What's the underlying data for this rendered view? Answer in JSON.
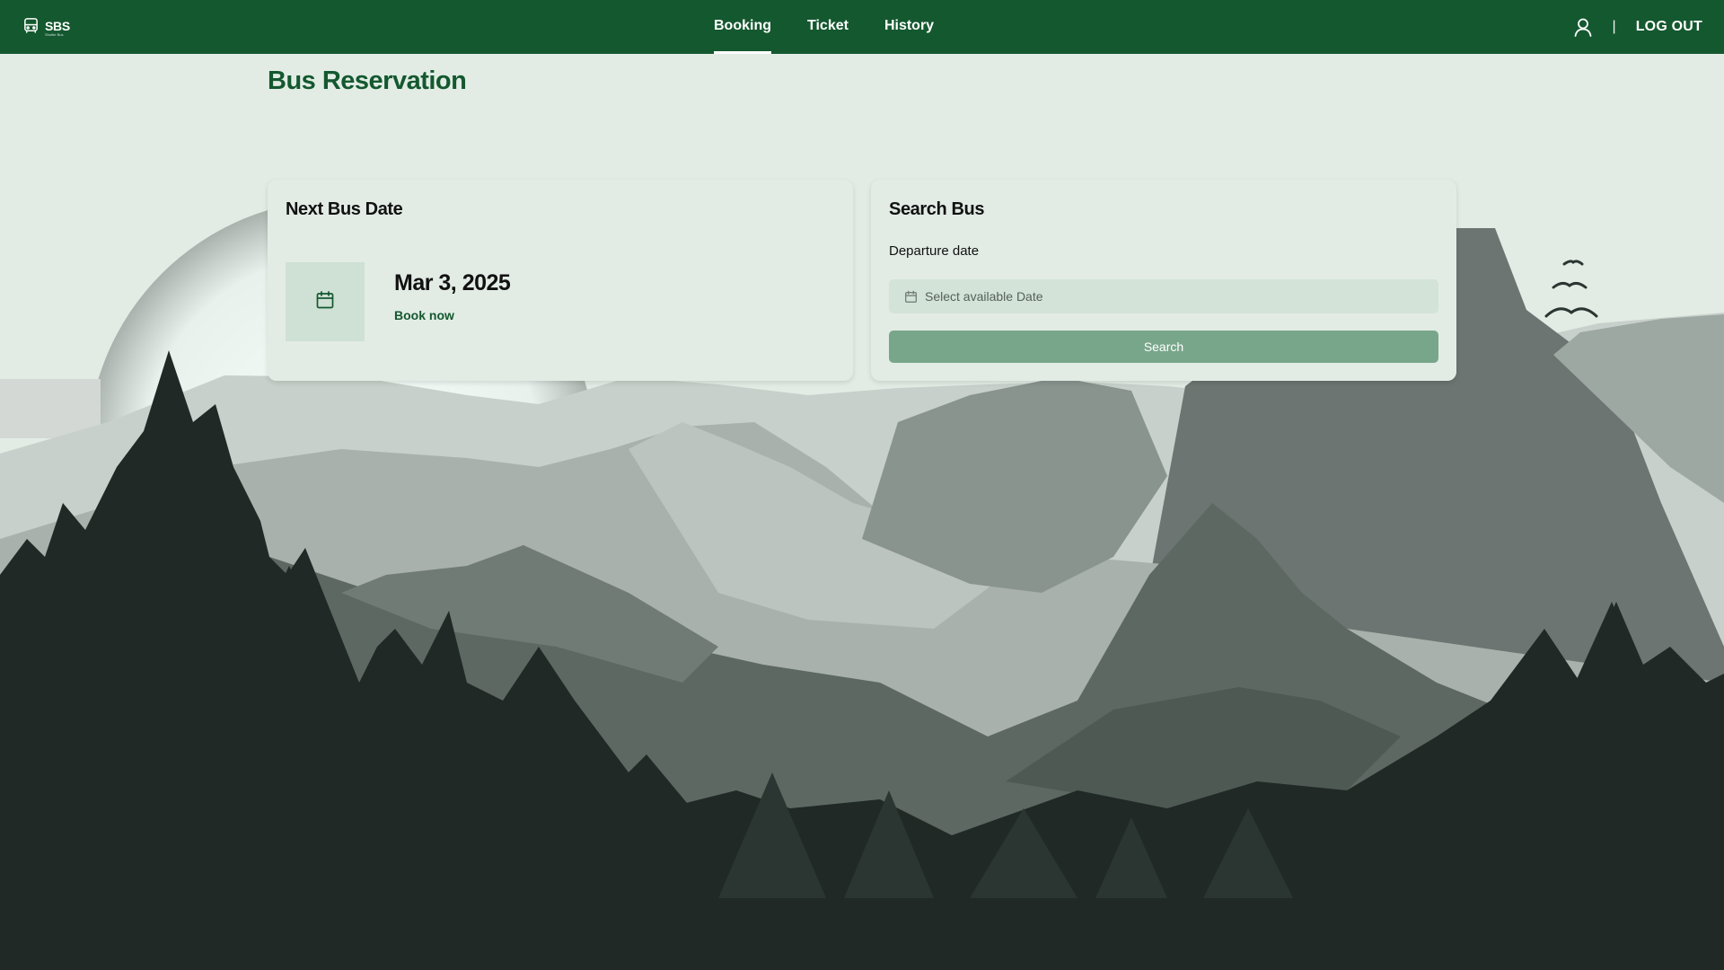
{
  "app": {
    "logo_text": "SBS",
    "logo_subtext": "Shuttle Bus"
  },
  "nav": {
    "items": [
      {
        "label": "Booking",
        "active": true
      },
      {
        "label": "Ticket",
        "active": false
      },
      {
        "label": "History",
        "active": false
      }
    ]
  },
  "header": {
    "separator": "|",
    "logout_label": "LOG OUT",
    "user_icon": "user-icon"
  },
  "page": {
    "title": "Bus Reservation"
  },
  "next_bus": {
    "title": "Next Bus Date",
    "date": "Mar 3, 2025",
    "action_label": "Book now",
    "icon": "calendar-icon"
  },
  "search_bus": {
    "title": "Search Bus",
    "field_label": "Departure date",
    "placeholder": "Select available Date",
    "button_label": "Search",
    "icon": "calendar-icon"
  },
  "colors": {
    "primary": "#14582f",
    "background": "#e2ece5",
    "button": "#78a68a",
    "input": "#d3e3d8",
    "tile": "#cfe0d4",
    "forest": "#202926"
  }
}
